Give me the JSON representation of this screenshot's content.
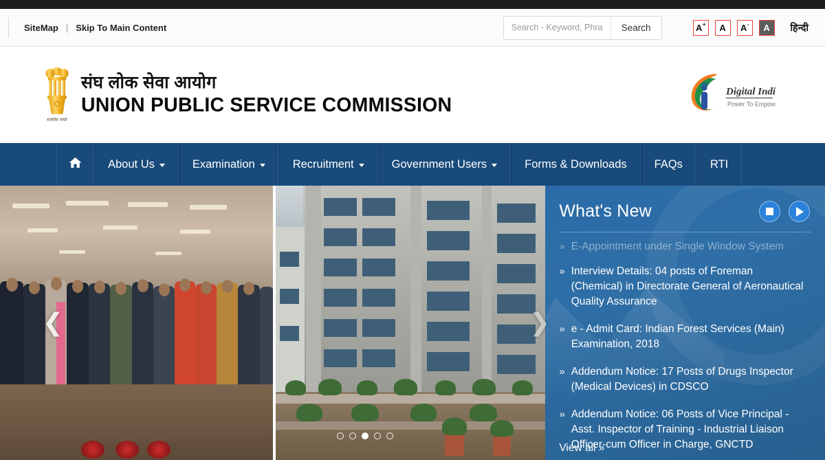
{
  "utility": {
    "sitemap_label": "SiteMap",
    "separator": "|",
    "skip_label": "Skip To Main Content",
    "hindi_label": "हिन्दी"
  },
  "search": {
    "placeholder": "Search - Keyword, Phrase",
    "value": "",
    "button_label": "Search"
  },
  "accessibility": {
    "increase": "A",
    "increase_sup": "+",
    "normal": "A",
    "decrease": "A",
    "decrease_sup": "-",
    "contrast": "A",
    "border_color": "#f0453a",
    "contrast_bg": "#5c5c5c"
  },
  "brand": {
    "hindi_title": "संघ लोक सेवा आयोग",
    "english_title": "UNION PUBLIC SERVICE COMMISSION",
    "emblem_motto": "सत्यमेव जयते",
    "digital_india_title": "Digital India",
    "digital_india_tagline": "Power To Empower"
  },
  "nav": {
    "bg_color": "#184a7a",
    "items": [
      {
        "label": "",
        "icon": "home-icon",
        "has_caret": false
      },
      {
        "label": "About Us",
        "icon": "",
        "has_caret": true
      },
      {
        "label": "Examination",
        "icon": "",
        "has_caret": true
      },
      {
        "label": "Recruitment",
        "icon": "",
        "has_caret": true
      },
      {
        "label": "Government Users",
        "icon": "",
        "has_caret": true
      },
      {
        "label": "Forms & Downloads",
        "icon": "",
        "has_caret": false
      },
      {
        "label": "FAQs",
        "icon": "",
        "has_caret": false
      },
      {
        "label": "RTI",
        "icon": "",
        "has_caret": false
      }
    ]
  },
  "carousel": {
    "prev_icon": "chevron-left-icon",
    "next_icon": "chevron-right-icon",
    "dot_count": 5,
    "active_dot": 3
  },
  "whats_new": {
    "title": "What's New",
    "stop_icon": "stop-icon",
    "play_icon": "play-icon",
    "accent_color": "#2a82da",
    "panel_color": "#2b6ca8",
    "bullet": "»",
    "items": [
      {
        "text": "E-Appointment under Single Window System",
        "faded": true
      },
      {
        "text": "Interview Details: 04 posts of Foreman (Chemical) in Directorate General of Aeronautical Quality Assurance",
        "faded": false
      },
      {
        "text": "e - Admit Card: Indian Forest Services (Main) Examination, 2018",
        "faded": false
      },
      {
        "text": "Addendum Notice: 17 Posts of Drugs Inspector (Medical Devices) in CDSCO",
        "faded": false
      },
      {
        "text": "Addendum Notice: 06 Posts of Vice Principal - Asst. Inspector of Training - Industrial Liaison Officer-cum Officer in Charge, GNCTD",
        "faded": false
      }
    ],
    "view_all_label": "View all »"
  }
}
